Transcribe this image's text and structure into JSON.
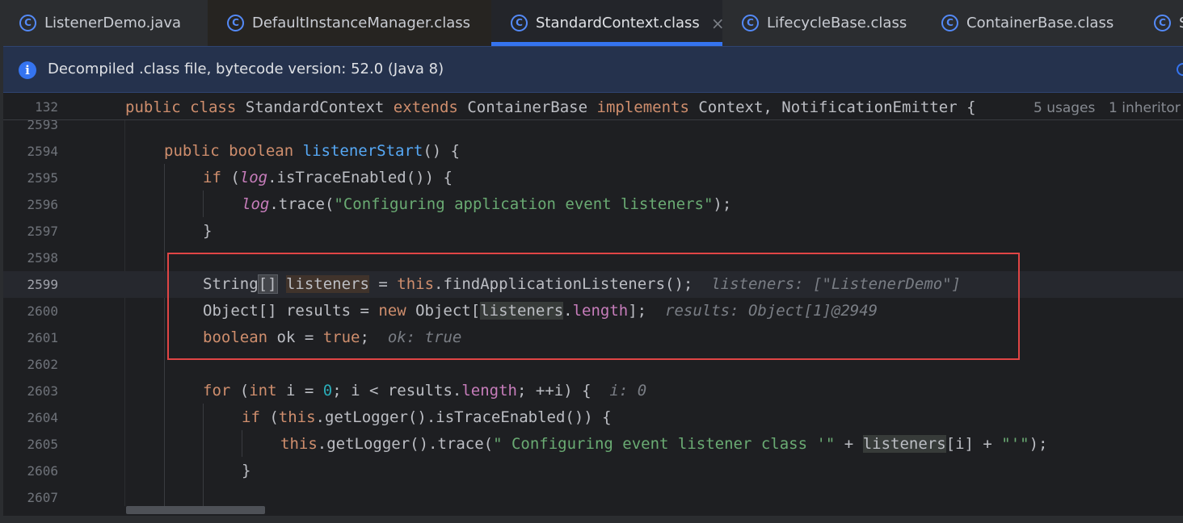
{
  "tabs": [
    {
      "label": "ListenerDemo.java",
      "icon": "class-c-icon"
    },
    {
      "label": "DefaultInstanceManager.class",
      "icon": "class-c-icon"
    },
    {
      "label": "StandardContext.class",
      "icon": "class-c-icon",
      "active": true,
      "close": "×"
    },
    {
      "label": "LifecycleBase.class",
      "icon": "class-c-icon"
    },
    {
      "label": "ContainerBase.class",
      "icon": "class-c-icon"
    },
    {
      "label": "S",
      "icon": "class-c-icon"
    }
  ],
  "icon_glyph": "C",
  "banner": {
    "icon_glyph": "i",
    "text": "Decompiled .class file, bytecode version: 52.0 (Java 8)"
  },
  "sticky": {
    "line": "132",
    "tokens": {
      "public": "public",
      "class": "class",
      "name": "StandardContext",
      "extends": "extends",
      "base": "ContainerBase",
      "implements": "implements",
      "ifaces": "Context, NotificationEmitter {"
    },
    "usages": "5 usages",
    "inheritors": "1 inheritor"
  },
  "lines": {
    "n2593": "2593",
    "n2594": "2594",
    "n2595": "2595",
    "n2596": "2596",
    "n2597": "2597",
    "n2598": "2598",
    "n2599": "2599",
    "n2600": "2600",
    "n2601": "2601",
    "n2602": "2602",
    "n2603": "2603",
    "n2604": "2604",
    "n2605": "2605",
    "n2606": "2606",
    "n2607": "2607"
  },
  "code": {
    "l2594": {
      "kw1": "public",
      "kw2": "boolean",
      "fn": "listenerStart",
      "rest": "() {"
    },
    "l2595": {
      "kw": "if",
      "open": " (",
      "field": "log",
      "rest": ".isTraceEnabled()) {"
    },
    "l2596": {
      "field": "log",
      "call": ".trace(",
      "str": "\"Configuring application event listeners\"",
      "end": ");"
    },
    "l2597": {
      "brace": "}"
    },
    "l2599": {
      "type": "String",
      "brackets": "[]",
      "var": "listeners",
      "eq": " = ",
      "kw": "this",
      "call": ".findApplicationListeners();",
      "hint": "listeners: [\"ListenerDemo\"]"
    },
    "l2600": {
      "pre": "Object[] results = ",
      "kw": "new",
      "obj": " Object[",
      "var": "listeners",
      "dot": ".",
      "fld": "length",
      "end": "];",
      "hint": "results: Object[1]@2949"
    },
    "l2601": {
      "kw": "boolean",
      "mid": " ok = ",
      "val": "true",
      "end": ";",
      "hint": "ok: true"
    },
    "l2603": {
      "kw": "for",
      "open": " (",
      "kw2": "int",
      "a": " i = ",
      "num": "0",
      "b": "; i < results.",
      "fld": "length",
      "c": "; ++i) {",
      "hint": "i: 0"
    },
    "l2604": {
      "kw": "if",
      "open": " (",
      "kw2": "this",
      "rest": ".getLogger().isTraceEnabled()) {"
    },
    "l2605": {
      "kw": "this",
      "call": ".getLogger().trace(",
      "str": "\" Configuring event listener class '\"",
      "plus": " + ",
      "var": "listeners",
      "idx": "[i] + ",
      "str2": "\"'\"",
      "end": ");"
    },
    "l2606": {
      "brace": "}"
    }
  }
}
